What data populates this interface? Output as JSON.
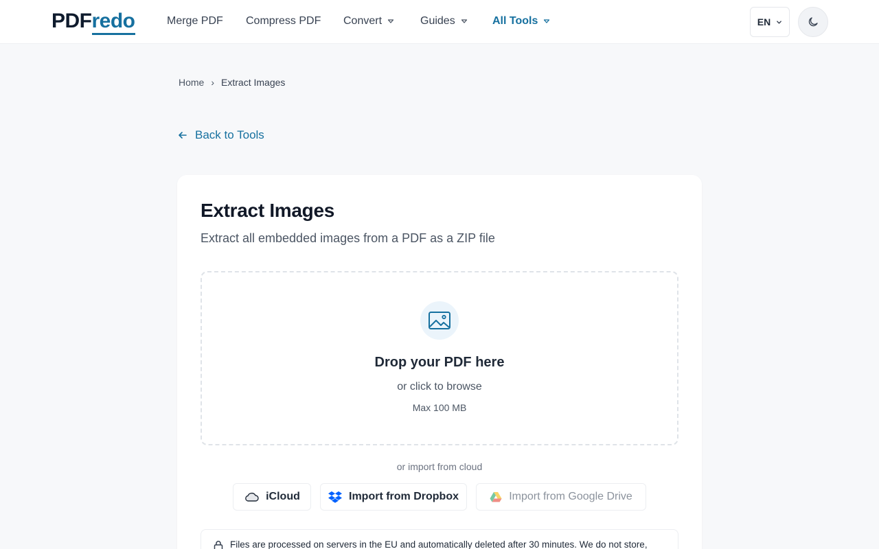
{
  "header": {
    "logo_part1": "PDF",
    "logo_part2": "redo",
    "nav": [
      {
        "label": "Merge PDF"
      },
      {
        "label": "Compress PDF"
      },
      {
        "label": "Convert"
      },
      {
        "label": "Guides"
      },
      {
        "label": "All Tools"
      }
    ],
    "language": "EN",
    "theme_icon": "moon-icon"
  },
  "breadcrumb": {
    "home": "Home",
    "separator": "›",
    "current": "Extract Images"
  },
  "back_link": "Back to Tools",
  "tool": {
    "title": "Extract Images",
    "subtitle": "Extract all embedded images from a PDF as a ZIP file",
    "dropzone": {
      "icon": "image-icon",
      "title": "Drop your PDF here",
      "subtitle": "or click to browse",
      "max_size": "Max 100 MB"
    },
    "cloud_label": "or import from cloud",
    "cloud_buttons": [
      {
        "label": "iCloud",
        "icon": "cloud-icon"
      },
      {
        "label": "Import from Dropbox",
        "icon": "dropbox-icon"
      },
      {
        "label": "Import from Google Drive",
        "icon": "google-drive-icon"
      }
    ],
    "notice": "Files are processed on servers in the EU and automatically deleted after 30 minutes. We do not store,"
  },
  "colors": {
    "accent": "#16709f",
    "background": "#f7f8fa",
    "dropbox": "#0061fe"
  }
}
